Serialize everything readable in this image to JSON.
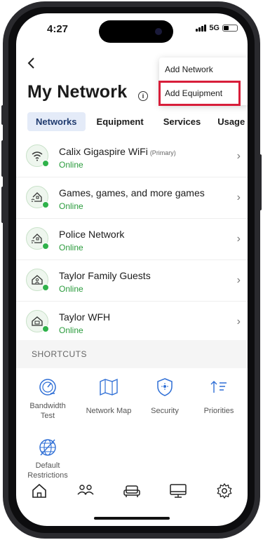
{
  "status": {
    "time": "4:27",
    "network": "5G",
    "colors": {
      "online": "#2fb24a",
      "highlight": "#d81e3a"
    }
  },
  "header": {
    "back_icon": "back-chevron-icon",
    "title": "My Network",
    "info_icon": "info-icon"
  },
  "menu": {
    "items": [
      "Add Network",
      "Add Equipment"
    ],
    "highlighted": "Add Equipment"
  },
  "tabs": {
    "items": [
      "Networks",
      "Equipment",
      "Services",
      "Usage"
    ],
    "active": "Networks"
  },
  "networks": [
    {
      "name": "Calix Gigaspire WiFi",
      "tag": "(Primary)",
      "status": "Online",
      "icon": "wifi-icon"
    },
    {
      "name": "Games, games, and more games",
      "tag": "",
      "status": "Online",
      "icon": "home-wifi-icon"
    },
    {
      "name": "Police Network",
      "tag": "",
      "status": "Online",
      "icon": "home-wifi-icon"
    },
    {
      "name": "Taylor Family Guests",
      "tag": "",
      "status": "Online",
      "icon": "home-guest-icon"
    },
    {
      "name": "Taylor WFH",
      "tag": "",
      "status": "Online",
      "icon": "home-office-icon"
    }
  ],
  "shortcuts": {
    "header": "SHORTCUTS",
    "items": [
      {
        "label": "Bandwidth Test",
        "icon": "speedometer-icon"
      },
      {
        "label": "Network Map",
        "icon": "map-icon"
      },
      {
        "label": "Security",
        "icon": "shield-icon"
      },
      {
        "label": "Priorities",
        "icon": "priority-sort-icon"
      },
      {
        "label": "Default Restrictions",
        "icon": "globe-restricted-icon"
      }
    ]
  },
  "bottom_nav": [
    "home-icon",
    "people-icon",
    "couch-icon",
    "monitor-icon",
    "settings-gear-icon"
  ]
}
